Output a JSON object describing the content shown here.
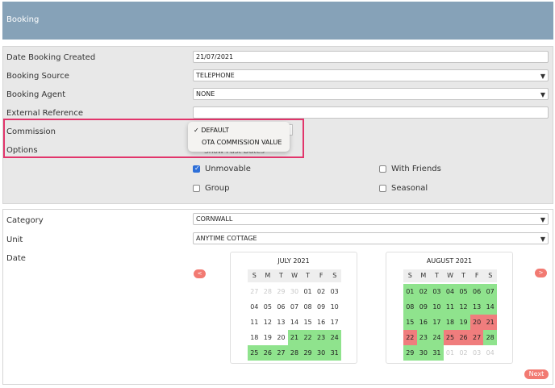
{
  "header": {
    "title": "Booking"
  },
  "booking": {
    "date_created_label": "Date Booking Created",
    "date_created_value": "21/07/2021",
    "source_label": "Booking Source",
    "source_value": "TELEPHONE",
    "agent_label": "Booking Agent",
    "agent_value": "NONE",
    "external_ref_label": "External Reference",
    "external_ref_value": "",
    "commission_label": "Commission",
    "options_label": "Options"
  },
  "commission_dropdown": {
    "options": [
      "DEFAULT",
      "OTA COMMISSION VALUE"
    ],
    "selected": "DEFAULT",
    "check_mark": "✓"
  },
  "options": {
    "hidden_text": "Show Past Dates",
    "unmovable": {
      "label": "Unmovable",
      "checked": true
    },
    "with_friends": {
      "label": "With Friends",
      "checked": false
    },
    "group": {
      "label": "Group",
      "checked": false
    },
    "seasonal": {
      "label": "Seasonal",
      "checked": false
    }
  },
  "property": {
    "category_label": "Category",
    "category_value": "CORNWALL",
    "unit_label": "Unit",
    "unit_value": "ANYTIME COTTAGE",
    "date_label": "Date"
  },
  "calendar": {
    "dow": [
      "S",
      "M",
      "T",
      "W",
      "T",
      "F",
      "S"
    ],
    "prev_label": "<",
    "next_label": ">",
    "months": [
      {
        "title": "JULY 2021",
        "weeks": [
          [
            [
              "27",
              "faded"
            ],
            [
              "28",
              "faded"
            ],
            [
              "29",
              "faded"
            ],
            [
              "30",
              "faded"
            ],
            [
              "01",
              ""
            ],
            [
              "02",
              ""
            ],
            [
              "03",
              ""
            ]
          ],
          [
            [
              "04",
              ""
            ],
            [
              "05",
              ""
            ],
            [
              "06",
              ""
            ],
            [
              "07",
              ""
            ],
            [
              "08",
              ""
            ],
            [
              "09",
              ""
            ],
            [
              "10",
              ""
            ]
          ],
          [
            [
              "11",
              ""
            ],
            [
              "12",
              ""
            ],
            [
              "13",
              ""
            ],
            [
              "14",
              ""
            ],
            [
              "15",
              ""
            ],
            [
              "16",
              ""
            ],
            [
              "17",
              ""
            ]
          ],
          [
            [
              "18",
              ""
            ],
            [
              "19",
              ""
            ],
            [
              "20",
              ""
            ],
            [
              "21",
              "green"
            ],
            [
              "22",
              "green"
            ],
            [
              "23",
              "green"
            ],
            [
              "24",
              "green"
            ]
          ],
          [
            [
              "25",
              "green"
            ],
            [
              "26",
              "green"
            ],
            [
              "27",
              "green"
            ],
            [
              "28",
              "green"
            ],
            [
              "29",
              "green"
            ],
            [
              "30",
              "green"
            ],
            [
              "31",
              "green"
            ]
          ]
        ]
      },
      {
        "title": "AUGUST 2021",
        "weeks": [
          [
            [
              "01",
              "green"
            ],
            [
              "02",
              "green"
            ],
            [
              "03",
              "green"
            ],
            [
              "04",
              "green"
            ],
            [
              "05",
              "green"
            ],
            [
              "06",
              "green"
            ],
            [
              "07",
              "green"
            ]
          ],
          [
            [
              "08",
              "green"
            ],
            [
              "09",
              "green"
            ],
            [
              "10",
              "green"
            ],
            [
              "11",
              "green"
            ],
            [
              "12",
              "green"
            ],
            [
              "13",
              "green"
            ],
            [
              "14",
              "green"
            ]
          ],
          [
            [
              "15",
              "green"
            ],
            [
              "16",
              "green"
            ],
            [
              "17",
              "green"
            ],
            [
              "18",
              "green"
            ],
            [
              "19",
              "green"
            ],
            [
              "20",
              "red"
            ],
            [
              "21",
              "red"
            ]
          ],
          [
            [
              "22",
              "red"
            ],
            [
              "23",
              "green"
            ],
            [
              "24",
              "green"
            ],
            [
              "25",
              "red"
            ],
            [
              "26",
              "red"
            ],
            [
              "27",
              "red"
            ],
            [
              "28",
              "green"
            ]
          ],
          [
            [
              "29",
              "green"
            ],
            [
              "30",
              "green"
            ],
            [
              "31",
              "green"
            ],
            [
              "01",
              "faded"
            ],
            [
              "02",
              "faded"
            ],
            [
              "03",
              "faded"
            ],
            [
              "04",
              "faded"
            ]
          ]
        ]
      }
    ]
  },
  "footer": {
    "next_label": "Next"
  },
  "colors": {
    "header": "#86a2b8",
    "available": "#8fe38d",
    "booked": "#f07d7d",
    "accent": "#f27a72",
    "highlight": "#e2356b"
  }
}
